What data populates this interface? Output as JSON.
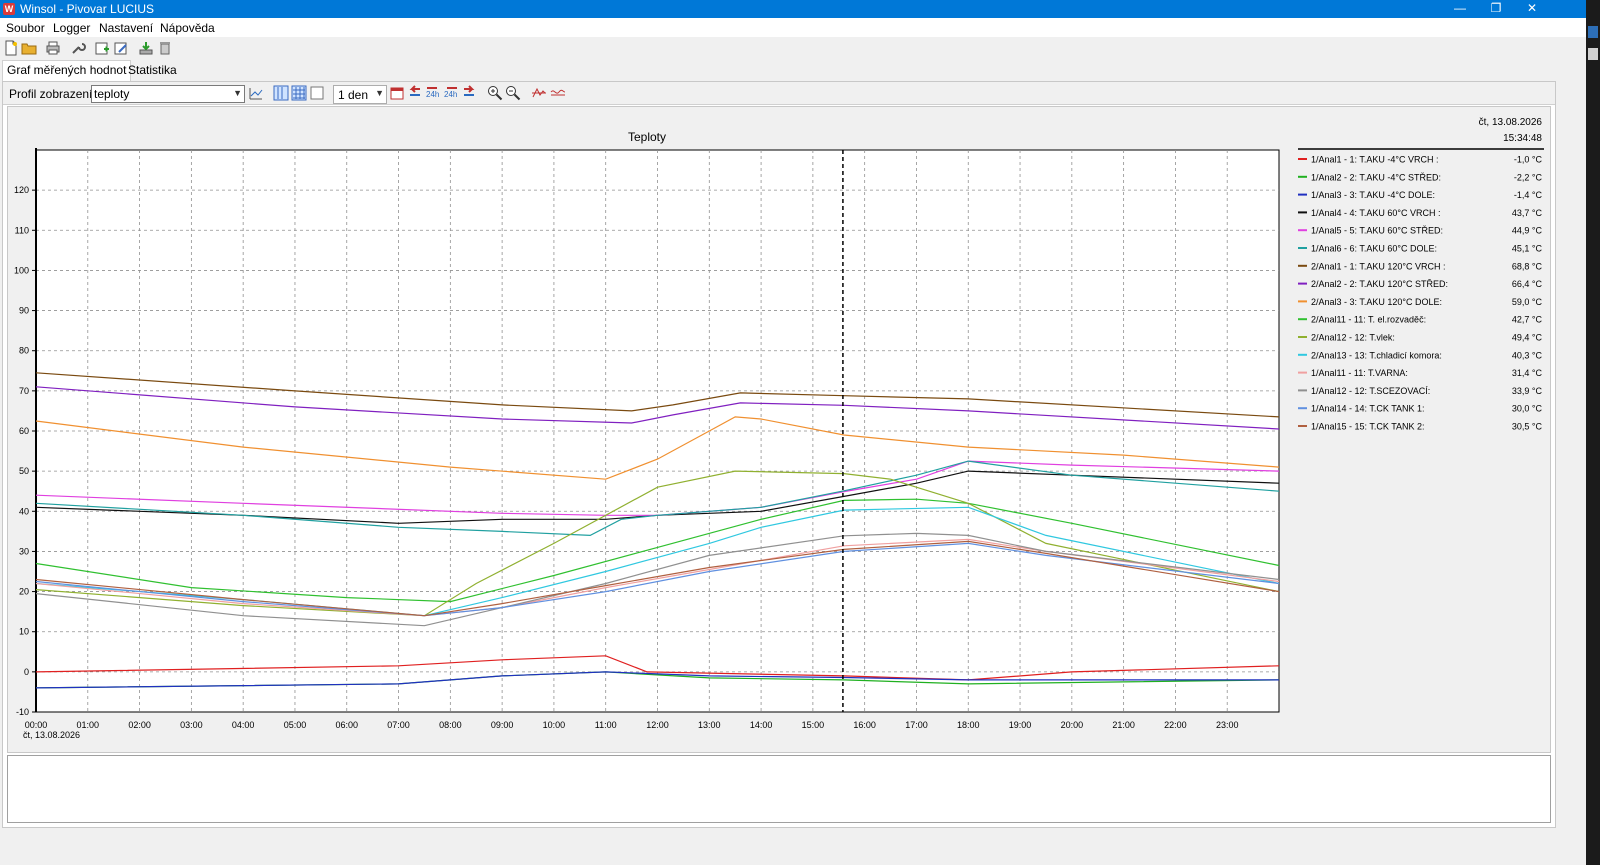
{
  "window": {
    "title": "Winsol - Pivovar LUCIUS",
    "minimize": "—",
    "restore": "❐",
    "close": "✕"
  },
  "menu": [
    "Soubor",
    "Logger",
    "Nastavení",
    "Nápověda"
  ],
  "tabs": [
    "Graf měřených hodnot",
    "Statistika"
  ],
  "toolbar": {
    "profile_label": "Profil zobrazení:",
    "profile_value": "teploty",
    "period_value": "1 den"
  },
  "chart_data": {
    "type": "line",
    "title": "Teploty",
    "date": "čt, 13.08.2026",
    "cursor_date": "čt, 13.08.2026",
    "cursor_time": "15:34:48",
    "cursor_x": 15.58,
    "xlim": [
      0,
      24
    ],
    "ylim": [
      -10,
      130
    ],
    "x_ticks": [
      "00:00",
      "01:00",
      "02:00",
      "03:00",
      "04:00",
      "05:00",
      "06:00",
      "07:00",
      "08:00",
      "09:00",
      "10:00",
      "11:00",
      "12:00",
      "13:00",
      "14:00",
      "15:00",
      "16:00",
      "17:00",
      "18:00",
      "19:00",
      "20:00",
      "21:00",
      "22:00",
      "23:00"
    ],
    "y_ticks": [
      -10,
      0,
      10,
      20,
      30,
      40,
      50,
      60,
      70,
      80,
      90,
      100,
      110,
      120
    ],
    "grid": true,
    "legend_position": "right",
    "series": [
      {
        "name": "1/Anal1 - 1: T.AKU -4°C VRCH :",
        "value": "-1,0 °C",
        "color": "#e02020",
        "points": [
          [
            0,
            0
          ],
          [
            7,
            1.5
          ],
          [
            9,
            3
          ],
          [
            11,
            4
          ],
          [
            11.8,
            0
          ],
          [
            15.6,
            -1
          ],
          [
            18,
            -2
          ],
          [
            20,
            0
          ],
          [
            24,
            1.5
          ]
        ]
      },
      {
        "name": "1/Anal2 - 2: T.AKU -4°C STŘED:",
        "value": "-2,2 °C",
        "color": "#20b020",
        "points": [
          [
            0,
            -4
          ],
          [
            7,
            -3
          ],
          [
            9,
            -1
          ],
          [
            11,
            0
          ],
          [
            13,
            -1.5
          ],
          [
            15.6,
            -2
          ],
          [
            18,
            -3
          ],
          [
            21,
            -2.5
          ],
          [
            24,
            -2
          ]
        ]
      },
      {
        "name": "1/Anal3 - 3: T.AKU -4°C DOLE:",
        "value": "-1,4 °C",
        "color": "#2030c0",
        "points": [
          [
            0,
            -4
          ],
          [
            7,
            -3
          ],
          [
            9,
            -1
          ],
          [
            11,
            0
          ],
          [
            13,
            -1
          ],
          [
            15.6,
            -1.4
          ],
          [
            18,
            -2
          ],
          [
            21,
            -2
          ],
          [
            24,
            -2
          ]
        ]
      },
      {
        "name": "1/Anal4 - 4: T.AKU 60°C VRCH :",
        "value": "43,7 °C",
        "color": "#101010",
        "points": [
          [
            0,
            41
          ],
          [
            4,
            39
          ],
          [
            7,
            37
          ],
          [
            9,
            38
          ],
          [
            11,
            38
          ],
          [
            12,
            39
          ],
          [
            14,
            40
          ],
          [
            15.6,
            43.7
          ],
          [
            17,
            47
          ],
          [
            18,
            50
          ],
          [
            20,
            49
          ],
          [
            24,
            47
          ]
        ]
      },
      {
        "name": "1/Anal5 - 5: T.AKU 60°C STŘED:",
        "value": "44,9 °C",
        "color": "#e040e0",
        "points": [
          [
            0,
            44
          ],
          [
            4,
            42
          ],
          [
            9,
            39.5
          ],
          [
            11,
            39
          ],
          [
            12,
            39
          ],
          [
            14,
            41
          ],
          [
            15.6,
            44.9
          ],
          [
            17,
            48
          ],
          [
            18,
            52.5
          ],
          [
            20,
            51.5
          ],
          [
            24,
            50
          ]
        ]
      },
      {
        "name": "1/Anal6 - 6: T.AKU 60°C DOLE:",
        "value": "45,1 °C",
        "color": "#20a0a0",
        "points": [
          [
            0,
            42
          ],
          [
            4,
            39
          ],
          [
            7,
            36
          ],
          [
            9,
            35
          ],
          [
            10.7,
            34
          ],
          [
            11.3,
            38
          ],
          [
            12,
            39
          ],
          [
            14,
            41
          ],
          [
            15.6,
            45.1
          ],
          [
            17,
            49
          ],
          [
            18,
            52.5
          ],
          [
            20,
            49
          ],
          [
            24,
            45
          ]
        ]
      },
      {
        "name": "2/Anal1 - 1: T.AKU 120°C VRCH :",
        "value": "68,8 °C",
        "color": "#7a4a10",
        "points": [
          [
            0,
            74.5
          ],
          [
            5,
            70
          ],
          [
            9,
            66.5
          ],
          [
            11.5,
            65
          ],
          [
            12.3,
            66.5
          ],
          [
            13.6,
            69.5
          ],
          [
            15.6,
            68.8
          ],
          [
            18,
            68
          ],
          [
            24,
            63.5
          ]
        ]
      },
      {
        "name": "2/Anal2 - 2: T.AKU 120°C STŘED:",
        "value": "66,4 °C",
        "color": "#8020c0",
        "points": [
          [
            0,
            71
          ],
          [
            5,
            66
          ],
          [
            9,
            63
          ],
          [
            11.5,
            62
          ],
          [
            12.3,
            64
          ],
          [
            13.6,
            67
          ],
          [
            15.6,
            66.4
          ],
          [
            18,
            65
          ],
          [
            24,
            60.5
          ]
        ]
      },
      {
        "name": "2/Anal3 - 3: T.AKU 120°C DOLE:",
        "value": "59,0 °C",
        "color": "#f09030",
        "points": [
          [
            0,
            62.5
          ],
          [
            4,
            56
          ],
          [
            8,
            51
          ],
          [
            11,
            48
          ],
          [
            12,
            53
          ],
          [
            13,
            60
          ],
          [
            13.5,
            63.5
          ],
          [
            14,
            63
          ],
          [
            15.6,
            59
          ],
          [
            18,
            56
          ],
          [
            21,
            54
          ],
          [
            24,
            51
          ]
        ]
      },
      {
        "name": "2/Anal11 - 11: T. el.rozvaděč:",
        "value": "42,7 °C",
        "color": "#30c030",
        "points": [
          [
            0,
            27
          ],
          [
            3,
            21
          ],
          [
            6,
            18.5
          ],
          [
            8,
            17.5
          ],
          [
            10,
            24
          ],
          [
            12,
            31
          ],
          [
            14,
            38
          ],
          [
            15.6,
            42.7
          ],
          [
            17,
            43
          ],
          [
            18,
            42
          ],
          [
            20,
            37
          ],
          [
            24,
            26.5
          ]
        ]
      },
      {
        "name": "2/Anal12 - 12: T.vlek:",
        "value": "49,4 °C",
        "color": "#90b030",
        "points": [
          [
            0,
            20.5
          ],
          [
            4,
            16.5
          ],
          [
            7.5,
            14
          ],
          [
            8.5,
            22
          ],
          [
            10,
            32
          ],
          [
            12,
            46
          ],
          [
            13.5,
            50
          ],
          [
            15.6,
            49.4
          ],
          [
            16.5,
            48
          ],
          [
            18,
            42
          ],
          [
            19.5,
            32
          ],
          [
            24,
            20
          ]
        ]
      },
      {
        "name": "2/Anal13 - 13: T.chladicí komora:",
        "value": "40,3 °C",
        "color": "#30c8e0",
        "points": [
          [
            0,
            22
          ],
          [
            4,
            18
          ],
          [
            7.5,
            14
          ],
          [
            9,
            18.5
          ],
          [
            11,
            25
          ],
          [
            13,
            32
          ],
          [
            14,
            36
          ],
          [
            15.6,
            40.3
          ],
          [
            18,
            41
          ],
          [
            19.5,
            34
          ],
          [
            24,
            22
          ]
        ]
      },
      {
        "name": "1/Anal11 - 11: T.VARNA:",
        "value": "31,4 °C",
        "color": "#f0a0a0",
        "points": [
          [
            0,
            22
          ],
          [
            4,
            17
          ],
          [
            7.5,
            14
          ],
          [
            9,
            16
          ],
          [
            11,
            21
          ],
          [
            13,
            25.5
          ],
          [
            15.6,
            31.4
          ],
          [
            18,
            33
          ],
          [
            19.5,
            30
          ],
          [
            24,
            22.5
          ]
        ]
      },
      {
        "name": "1/Anal12 - 12: T.SCEZOVACÍ:",
        "value": "33,9 °C",
        "color": "#909090",
        "points": [
          [
            0,
            19.5
          ],
          [
            4,
            14
          ],
          [
            7.5,
            11.5
          ],
          [
            9,
            16
          ],
          [
            11,
            22
          ],
          [
            13,
            29
          ],
          [
            15.6,
            33.9
          ],
          [
            17,
            34.5
          ],
          [
            18,
            34
          ],
          [
            19.5,
            30
          ],
          [
            24,
            23
          ]
        ]
      },
      {
        "name": "1/Anal14 - 14: T.CK TANK 1:",
        "value": "30,0 °C",
        "color": "#6090e0",
        "points": [
          [
            0,
            22.5
          ],
          [
            4,
            17.5
          ],
          [
            7.5,
            14
          ],
          [
            9,
            16
          ],
          [
            11,
            20
          ],
          [
            13,
            25
          ],
          [
            15.6,
            30
          ],
          [
            18,
            32
          ],
          [
            19.5,
            29
          ],
          [
            24,
            22
          ]
        ]
      },
      {
        "name": "1/Anal15 - 15: T.CK TANK 2:",
        "value": "30,5 °C",
        "color": "#b06040",
        "points": [
          [
            0,
            23
          ],
          [
            4,
            18
          ],
          [
            7.5,
            14
          ],
          [
            9,
            17
          ],
          [
            11,
            21.5
          ],
          [
            13,
            26
          ],
          [
            15.6,
            30.5
          ],
          [
            18,
            32.5
          ],
          [
            19.5,
            29.5
          ],
          [
            24,
            20
          ]
        ]
      }
    ]
  }
}
